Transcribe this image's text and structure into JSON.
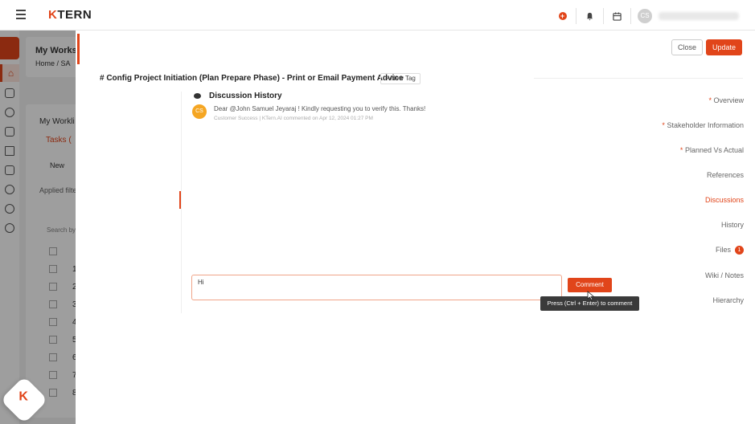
{
  "topbar": {
    "logo_k": "K",
    "logo_rest": "TERN",
    "user_initials": "CS"
  },
  "background": {
    "workspace_title": "My Worksp",
    "breadcrumb": "Home  /  SA",
    "worklist_title": "My Workli",
    "tasks_tab": "Tasks (",
    "new_btn": "New",
    "applied_filters": "Applied filte",
    "search_by": "Search by",
    "row_numbers": [
      "1",
      "2",
      "3",
      "4",
      "5",
      "6",
      "7",
      "8"
    ]
  },
  "panel": {
    "close_label": "Close",
    "update_label": "Update",
    "task_title": "# Config Project Initiation (Plan Prepare Phase) - Print or Email Payment Advice",
    "new_tag_label": "+ New Tag",
    "nav": [
      {
        "label": "Overview",
        "required": "*"
      },
      {
        "label": "Stakeholder Information",
        "required": "*"
      },
      {
        "label": "Planned Vs Actual",
        "required": "*"
      },
      {
        "label": "References",
        "required": ""
      },
      {
        "label": "Discussions",
        "required": ""
      },
      {
        "label": "History",
        "required": ""
      },
      {
        "label": "Files",
        "required": ""
      },
      {
        "label": "Wiki / Notes",
        "required": ""
      },
      {
        "label": "Hierarchy",
        "required": ""
      }
    ],
    "files_badge": "1",
    "discussion": {
      "title": "Discussion History",
      "comment_avatar": "CS",
      "comment_text": "Dear @John Samuel Jeyaraj ! Kindly requesting you to verify this. Thanks!",
      "comment_meta": "Customer Success | KTern.AI commented on Apr 12, 2024 01:27 PM"
    },
    "input_value": "Hi",
    "comment_button": "Comment",
    "tooltip": "Press (Ctrl + Enter) to comment"
  },
  "colors": {
    "accent": "#e1451a",
    "avatar_comment": "#f5a623"
  }
}
